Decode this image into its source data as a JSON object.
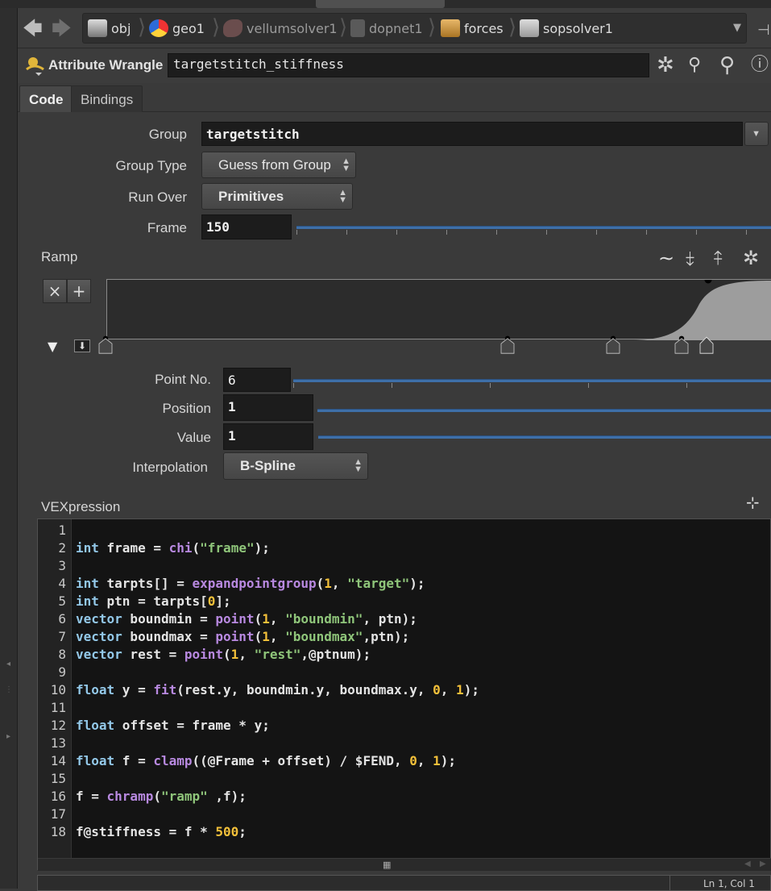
{
  "path_bar": {
    "crumbs": [
      {
        "label": "obj",
        "icon": "scene-icon"
      },
      {
        "label": "geo1",
        "icon": "geo-icon"
      },
      {
        "label": "vellumsolver1",
        "icon": "vellum-icon"
      },
      {
        "label": "dopnet1",
        "icon": "dopnet-icon"
      },
      {
        "label": "forces",
        "icon": "box-icon"
      },
      {
        "label": "sopsolver1",
        "icon": "sopsolver-icon"
      }
    ]
  },
  "node": {
    "type_label": "Attribute Wrangle",
    "name": "targetstitch_stiffness"
  },
  "tabs": [
    {
      "label": "Code",
      "active": true
    },
    {
      "label": "Bindings",
      "active": false
    }
  ],
  "params": {
    "group": {
      "label": "Group",
      "value": "targetstitch"
    },
    "group_type": {
      "label": "Group Type",
      "value": "Guess from Group"
    },
    "run_over": {
      "label": "Run Over",
      "value": "Primitives"
    },
    "frame": {
      "label": "Frame",
      "value": "150"
    }
  },
  "ramp": {
    "label": "Ramp",
    "point_no": {
      "label": "Point No.",
      "value": "6"
    },
    "position": {
      "label": "Position",
      "value": "1"
    },
    "value": {
      "label": "Value",
      "value": "1"
    },
    "interpolation": {
      "label": "Interpolation",
      "value": "B-Spline"
    }
  },
  "vex": {
    "label": "VEXpression",
    "line_numbers": [
      "1",
      "2",
      "3",
      "4",
      "5",
      "6",
      "7",
      "8",
      "9",
      "10",
      "11",
      "12",
      "13",
      "14",
      "15",
      "16",
      "17",
      "18"
    ],
    "lines": [
      "",
      "int frame = chi(\"frame\");",
      "",
      "int tarpts[] = expandpointgroup(1, \"target\");",
      "int ptn = tarpts[0];",
      "vector boundmin = point(1, \"boundmin\", ptn);",
      "vector boundmax = point(1, \"boundmax\",ptn);",
      "vector rest = point(1, \"rest\",@ptnum);",
      "",
      "float y = fit(rest.y, boundmin.y, boundmax.y, 0, 1);",
      "",
      "float offset = frame * y;",
      "",
      "float f = clamp((@Frame + offset) / $FEND, 0, 1);",
      "",
      "f = chramp(\"ramp\" ,f);",
      "",
      "f@stiffness = f * 500;"
    ]
  },
  "status": {
    "cursor": "Ln 1, Col 1"
  },
  "colors": {
    "slider": "#3e6fa8",
    "keyword": "#93c8e8",
    "function": "#b889e0",
    "string": "#8fc57a",
    "number": "#f3c03a"
  }
}
